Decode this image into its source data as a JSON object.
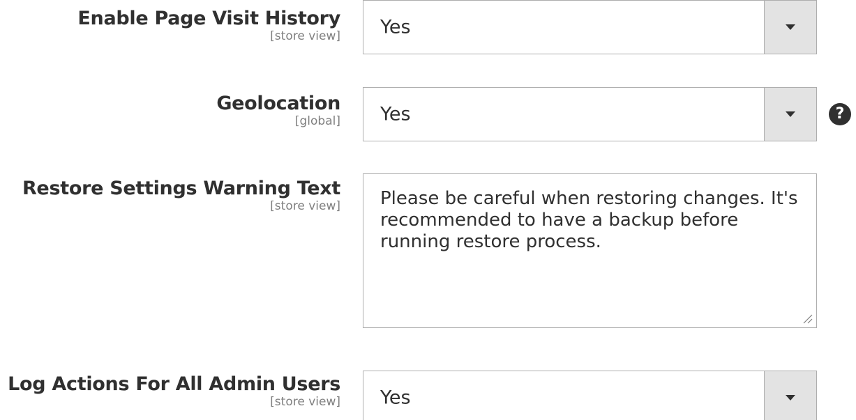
{
  "fields": [
    {
      "label": "Enable Page Visit History",
      "scope": "[store view]",
      "value": "Yes"
    },
    {
      "label": "Geolocation",
      "scope": "[global]",
      "value": "Yes",
      "help_icon": "question-circle-icon",
      "help_glyph": "?"
    },
    {
      "label": "Restore Settings Warning Text",
      "scope": "[store view]",
      "value": "Please be careful when restoring changes. It's recommended to have a backup before running restore process."
    },
    {
      "label": "Log Actions For All Admin Users",
      "scope": "[store view]",
      "value": "Yes"
    }
  ],
  "icons": {
    "dropdown": "chevron-down-icon",
    "resize": "resize-grip-icon"
  },
  "colors": {
    "text": "#303030",
    "scope": "#808080",
    "border": "#adadad",
    "toggle_bg": "#e3e3e3",
    "help_bg": "#303030"
  }
}
